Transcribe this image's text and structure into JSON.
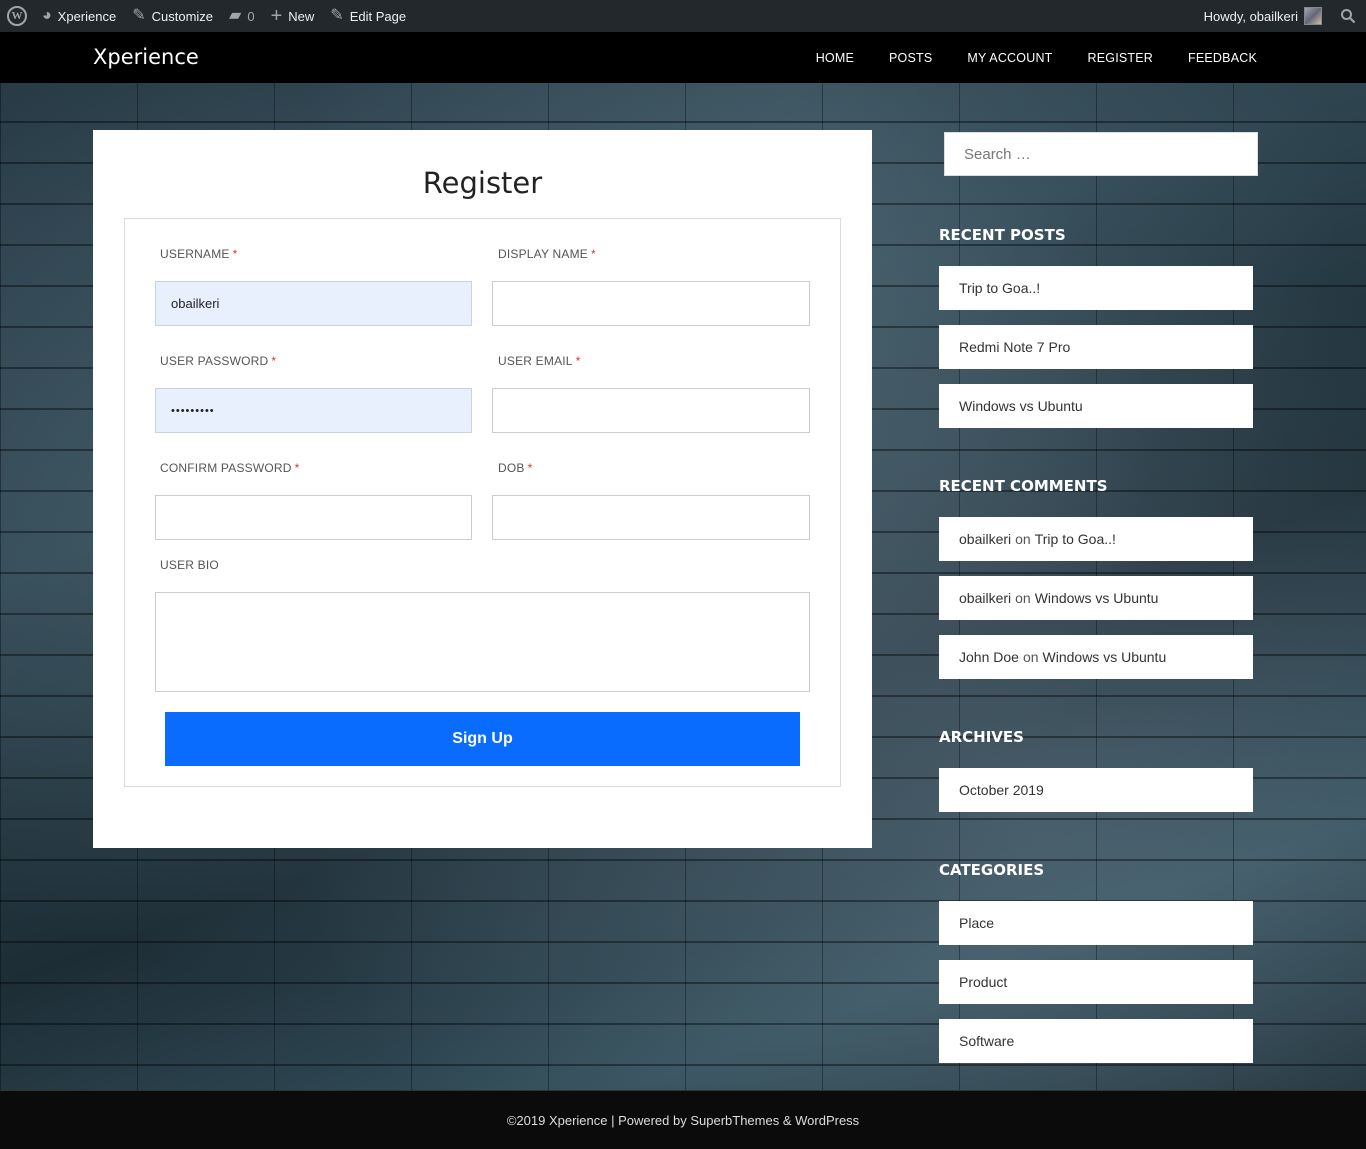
{
  "adminbar": {
    "site_name": "Xperience",
    "customize": "Customize",
    "comments_count": "0",
    "new": "New",
    "edit_page": "Edit Page",
    "howdy": "Howdy, obailkeri"
  },
  "header": {
    "site_title": "Xperience",
    "nav": [
      "HOME",
      "POSTS",
      "MY ACCOUNT",
      "REGISTER",
      "FEEDBACK"
    ]
  },
  "form": {
    "title": "Register",
    "required_mark": "*",
    "username_label": "USERNAME",
    "username_value": "obailkeri",
    "display_name_label": "DISPLAY NAME",
    "display_name_value": "",
    "password_label": "USER PASSWORD",
    "password_value": "•••••••••",
    "email_label": "USER EMAIL",
    "email_value": "",
    "confirm_password_label": "CONFIRM PASSWORD",
    "confirm_password_value": "",
    "dob_label": "DOB",
    "dob_value": "",
    "bio_label": "USER BIO",
    "bio_value": "",
    "submit_label": "Sign Up",
    "submit_color": "#0a6cff"
  },
  "sidebar": {
    "search_placeholder": "Search …",
    "recent_posts_title": "RECENT POSTS",
    "recent_posts": [
      "Trip to Goa..!",
      "Redmi Note 7 Pro",
      "Windows vs Ubuntu"
    ],
    "recent_comments_title": "RECENT COMMENTS",
    "recent_comments": [
      {
        "author": "obailkeri",
        "on": "on",
        "post": "Trip to Goa..!"
      },
      {
        "author": "obailkeri",
        "on": "on",
        "post": "Windows vs Ubuntu"
      },
      {
        "author": "John Doe",
        "on": "on",
        "post": "Windows vs Ubuntu"
      }
    ],
    "archives_title": "ARCHIVES",
    "archives": [
      "October 2019"
    ],
    "categories_title": "CATEGORIES",
    "categories": [
      "Place",
      "Product",
      "Software"
    ]
  },
  "footer": {
    "text": "©2019 Xperience | Powered by SuperbThemes & WordPress"
  }
}
